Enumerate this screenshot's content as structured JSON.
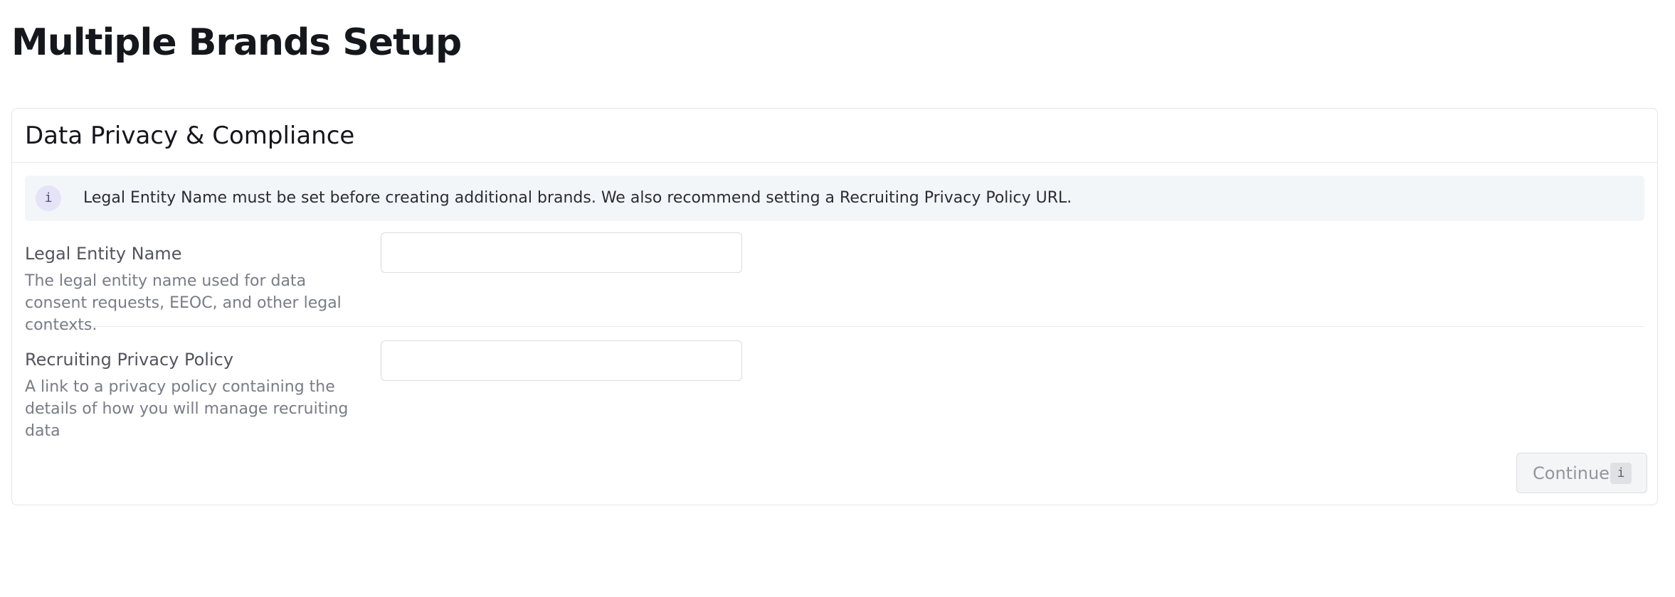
{
  "page": {
    "title": "Multiple Brands Setup"
  },
  "section": {
    "title": "Data Privacy & Compliance",
    "notice": {
      "icon": "info-icon",
      "icon_glyph": "i",
      "text": "Legal Entity Name must be set before creating additional brands. We also recommend setting a Recruiting Privacy Policy URL."
    }
  },
  "fields": [
    {
      "label": "Legal Entity Name",
      "description": "The legal entity name used for data consent requests, EEOC, and other legal contexts.",
      "value": "",
      "placeholder": ""
    },
    {
      "label": "Recruiting Privacy Policy",
      "description": "A link to a privacy policy containing the details of how you will manage recruiting data",
      "value": "",
      "placeholder": ""
    }
  ],
  "actions": {
    "continue_label": "Continue",
    "continue_shortcut": "i",
    "continue_disabled": true
  },
  "colors": {
    "notice_background": "#f3f6f8",
    "notice_icon_background": "#e4e3f7",
    "disabled_button_text": "#93949d"
  }
}
